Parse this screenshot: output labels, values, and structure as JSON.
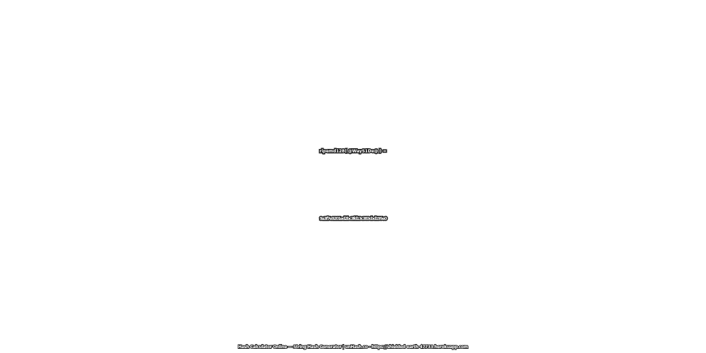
{
  "expression": "ripemd128( @WayS1De@ ) =",
  "hash_value": "9a3f7e9201ed2bc3fd13c383cbd195e0",
  "footer": "Hash Calculator Online — String Hash Generator | unHash.co - https://shielded-earth-47733.herokuapp.com",
  "colors": {
    "background": "#ffffff",
    "text_fill": "#ffffff",
    "text_outline": "#1a1a1a"
  }
}
